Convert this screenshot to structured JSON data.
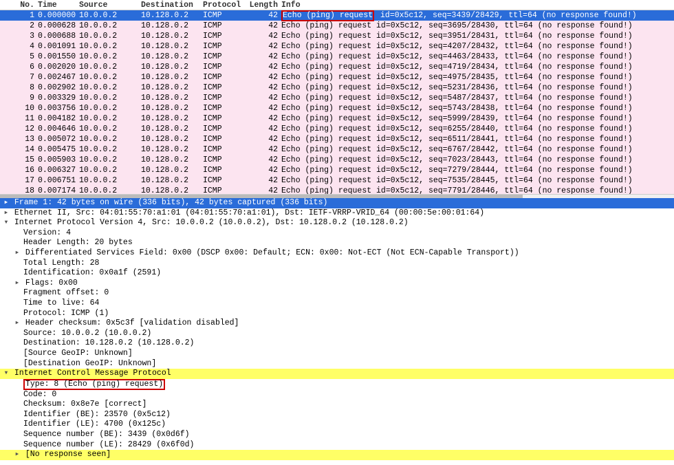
{
  "columns": {
    "no": "No.",
    "time": "Time",
    "source": "Source",
    "destination": "Destination",
    "protocol": "Protocol",
    "length": "Length",
    "info": "Info"
  },
  "packets": [
    {
      "no": "1",
      "time": "0.000000",
      "src": "10.0.0.2",
      "dst": "10.128.0.2",
      "prot": "ICMP",
      "len": "42",
      "info_main": "Echo (ping) request",
      "info_rest": "  id=0x5c12, seq=3439/28429, ttl=64 (no response found!)",
      "selected": true,
      "box_main": true
    },
    {
      "no": "2",
      "time": "0.000628",
      "src": "10.0.0.2",
      "dst": "10.128.0.2",
      "prot": "ICMP",
      "len": "42",
      "info_main": "Echo (ping) request",
      "info_rest": "  id=0x5c12, seq=3695/28430, ttl=64 (no response found!)"
    },
    {
      "no": "3",
      "time": "0.000688",
      "src": "10.0.0.2",
      "dst": "10.128.0.2",
      "prot": "ICMP",
      "len": "42",
      "info_main": "Echo (ping) request",
      "info_rest": "  id=0x5c12, seq=3951/28431, ttl=64 (no response found!)"
    },
    {
      "no": "4",
      "time": "0.001091",
      "src": "10.0.0.2",
      "dst": "10.128.0.2",
      "prot": "ICMP",
      "len": "42",
      "info_main": "Echo (ping) request",
      "info_rest": "  id=0x5c12, seq=4207/28432, ttl=64 (no response found!)"
    },
    {
      "no": "5",
      "time": "0.001550",
      "src": "10.0.0.2",
      "dst": "10.128.0.2",
      "prot": "ICMP",
      "len": "42",
      "info_main": "Echo (ping) request",
      "info_rest": "  id=0x5c12, seq=4463/28433, ttl=64 (no response found!)"
    },
    {
      "no": "6",
      "time": "0.002020",
      "src": "10.0.0.2",
      "dst": "10.128.0.2",
      "prot": "ICMP",
      "len": "42",
      "info_main": "Echo (ping) request",
      "info_rest": "  id=0x5c12, seq=4719/28434, ttl=64 (no response found!)"
    },
    {
      "no": "7",
      "time": "0.002467",
      "src": "10.0.0.2",
      "dst": "10.128.0.2",
      "prot": "ICMP",
      "len": "42",
      "info_main": "Echo (ping) request",
      "info_rest": "  id=0x5c12, seq=4975/28435, ttl=64 (no response found!)"
    },
    {
      "no": "8",
      "time": "0.002902",
      "src": "10.0.0.2",
      "dst": "10.128.0.2",
      "prot": "ICMP",
      "len": "42",
      "info_main": "Echo (ping) request",
      "info_rest": "  id=0x5c12, seq=5231/28436, ttl=64 (no response found!)"
    },
    {
      "no": "9",
      "time": "0.003329",
      "src": "10.0.0.2",
      "dst": "10.128.0.2",
      "prot": "ICMP",
      "len": "42",
      "info_main": "Echo (ping) request",
      "info_rest": "  id=0x5c12, seq=5487/28437, ttl=64 (no response found!)"
    },
    {
      "no": "10",
      "time": "0.003756",
      "src": "10.0.0.2",
      "dst": "10.128.0.2",
      "prot": "ICMP",
      "len": "42",
      "info_main": "Echo (ping) request",
      "info_rest": "  id=0x5c12, seq=5743/28438, ttl=64 (no response found!)"
    },
    {
      "no": "11",
      "time": "0.004182",
      "src": "10.0.0.2",
      "dst": "10.128.0.2",
      "prot": "ICMP",
      "len": "42",
      "info_main": "Echo (ping) request",
      "info_rest": "  id=0x5c12, seq=5999/28439, ttl=64 (no response found!)"
    },
    {
      "no": "12",
      "time": "0.004646",
      "src": "10.0.0.2",
      "dst": "10.128.0.2",
      "prot": "ICMP",
      "len": "42",
      "info_main": "Echo (ping) request",
      "info_rest": "  id=0x5c12, seq=6255/28440, ttl=64 (no response found!)"
    },
    {
      "no": "13",
      "time": "0.005072",
      "src": "10.0.0.2",
      "dst": "10.128.0.2",
      "prot": "ICMP",
      "len": "42",
      "info_main": "Echo (ping) request",
      "info_rest": "  id=0x5c12, seq=6511/28441, ttl=64 (no response found!)"
    },
    {
      "no": "14",
      "time": "0.005475",
      "src": "10.0.0.2",
      "dst": "10.128.0.2",
      "prot": "ICMP",
      "len": "42",
      "info_main": "Echo (ping) request",
      "info_rest": "  id=0x5c12, seq=6767/28442, ttl=64 (no response found!)"
    },
    {
      "no": "15",
      "time": "0.005903",
      "src": "10.0.0.2",
      "dst": "10.128.0.2",
      "prot": "ICMP",
      "len": "42",
      "info_main": "Echo (ping) request",
      "info_rest": "  id=0x5c12, seq=7023/28443, ttl=64 (no response found!)"
    },
    {
      "no": "16",
      "time": "0.006327",
      "src": "10.0.0.2",
      "dst": "10.128.0.2",
      "prot": "ICMP",
      "len": "42",
      "info_main": "Echo (ping) request",
      "info_rest": "  id=0x5c12, seq=7279/28444, ttl=64 (no response found!)"
    },
    {
      "no": "17",
      "time": "0.006751",
      "src": "10.0.0.2",
      "dst": "10.128.0.2",
      "prot": "ICMP",
      "len": "42",
      "info_main": "Echo (ping) request",
      "info_rest": "  id=0x5c12, seq=7535/28445, ttl=64 (no response found!)"
    },
    {
      "no": "18",
      "time": "0.007174",
      "src": "10.0.0.2",
      "dst": "10.128.0.2",
      "prot": "ICMP",
      "len": "42",
      "info_main": "Echo (ping) request",
      "info_rest": "  id=0x5c12, seq=7791/28446, ttl=64 (no response found!)"
    }
  ],
  "details": [
    {
      "cls": "d-frame",
      "tri": "▸",
      "indent": 0,
      "text": "Frame 1: 42 bytes on wire (336 bits), 42 bytes captured (336 bits)"
    },
    {
      "cls": "",
      "tri": "▸",
      "indent": 0,
      "text": "Ethernet II, Src: 04:01:55:70:a1:01 (04:01:55:70:a1:01), Dst: IETF-VRRP-VRID_64 (00:00:5e:00:01:64)"
    },
    {
      "cls": "",
      "tri": "▾",
      "indent": 0,
      "text": "Internet Protocol Version 4, Src: 10.0.0.2 (10.0.0.2), Dst: 10.128.0.2 (10.128.0.2)"
    },
    {
      "cls": "",
      "tri": "",
      "indent": 2,
      "text": "Version: 4"
    },
    {
      "cls": "",
      "tri": "",
      "indent": 2,
      "text": "Header Length: 20 bytes"
    },
    {
      "cls": "",
      "tri": "▸",
      "indent": 1,
      "text": "Differentiated Services Field: 0x00 (DSCP 0x00: Default; ECN: 0x00: Not-ECT (Not ECN-Capable Transport))"
    },
    {
      "cls": "",
      "tri": "",
      "indent": 2,
      "text": "Total Length: 28"
    },
    {
      "cls": "",
      "tri": "",
      "indent": 2,
      "text": "Identification: 0x0a1f (2591)"
    },
    {
      "cls": "",
      "tri": "▸",
      "indent": 1,
      "text": "Flags: 0x00"
    },
    {
      "cls": "",
      "tri": "",
      "indent": 2,
      "text": "Fragment offset: 0"
    },
    {
      "cls": "",
      "tri": "",
      "indent": 2,
      "text": "Time to live: 64"
    },
    {
      "cls": "",
      "tri": "",
      "indent": 2,
      "text": "Protocol: ICMP (1)"
    },
    {
      "cls": "",
      "tri": "▸",
      "indent": 1,
      "text": "Header checksum: 0x5c3f [validation disabled]"
    },
    {
      "cls": "",
      "tri": "",
      "indent": 2,
      "text": "Source: 10.0.0.2 (10.0.0.2)"
    },
    {
      "cls": "",
      "tri": "",
      "indent": 2,
      "text": "Destination: 10.128.0.2 (10.128.0.2)"
    },
    {
      "cls": "",
      "tri": "",
      "indent": 2,
      "text": "[Source GeoIP: Unknown]"
    },
    {
      "cls": "",
      "tri": "",
      "indent": 2,
      "text": "[Destination GeoIP: Unknown]"
    },
    {
      "cls": "d-highlight",
      "tri": "▾",
      "indent": 0,
      "text": "Internet Control Message Protocol"
    },
    {
      "cls": "",
      "tri": "",
      "indent": 2,
      "text": "Type: 8 (Echo (ping) request)",
      "box": true
    },
    {
      "cls": "",
      "tri": "",
      "indent": 2,
      "text": "Code: 0"
    },
    {
      "cls": "",
      "tri": "",
      "indent": 2,
      "text": "Checksum: 0x8e7e [correct]"
    },
    {
      "cls": "",
      "tri": "",
      "indent": 2,
      "text": "Identifier (BE): 23570 (0x5c12)"
    },
    {
      "cls": "",
      "tri": "",
      "indent": 2,
      "text": "Identifier (LE): 4700 (0x125c)"
    },
    {
      "cls": "",
      "tri": "",
      "indent": 2,
      "text": "Sequence number (BE): 3439 (0x0d6f)"
    },
    {
      "cls": "",
      "tri": "",
      "indent": 2,
      "text": "Sequence number (LE): 28429 (0x6f0d)"
    },
    {
      "cls": "d-highlight",
      "tri": "▸",
      "indent": 1,
      "text": "[No response seen]"
    }
  ]
}
